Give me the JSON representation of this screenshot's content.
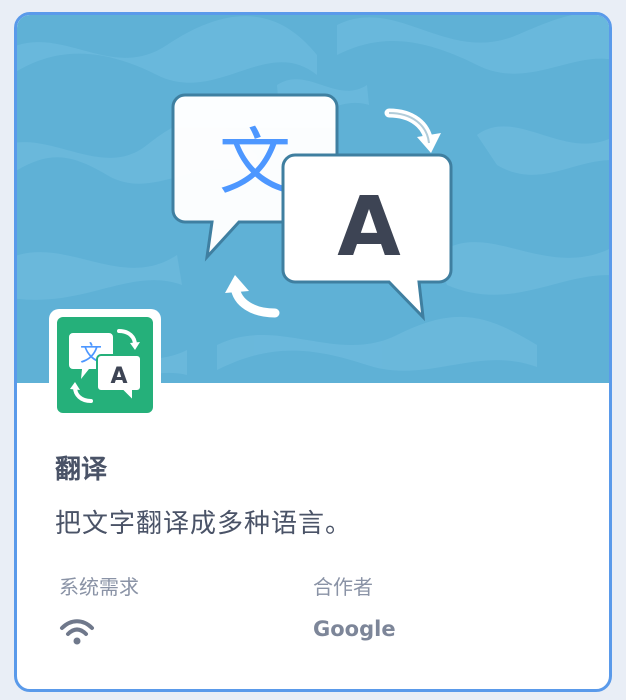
{
  "extension": {
    "title": "翻译",
    "description": "把文字翻译成多种语言。",
    "hero_glyph_source": "文",
    "hero_glyph_target": "A",
    "icon_glyph_source": "文",
    "icon_glyph_target": "A"
  },
  "meta": {
    "requirements_label": "系统需求",
    "requirements_icon": "wifi-icon",
    "collaborator_label": "合作者",
    "collaborator_value": "Google"
  },
  "colors": {
    "border": "#5a9aea",
    "banner": "#5fb1d6",
    "icon_bg": "#25b07a",
    "text_primary": "#4a5367",
    "text_secondary": "#8a93a6",
    "accent_blue": "#4d97ff"
  }
}
